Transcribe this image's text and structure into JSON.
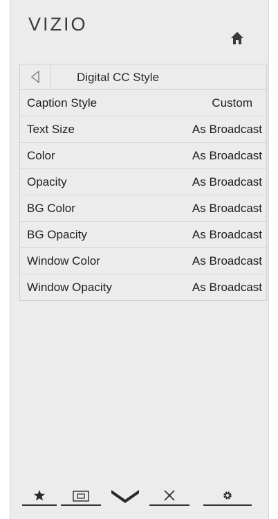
{
  "brand": {
    "logo_text": "VIZIO"
  },
  "header": {
    "home_icon": "home-icon"
  },
  "menu": {
    "title": "Digital CC Style",
    "back_icon": "back-triangle-icon",
    "rows": [
      {
        "label": "Caption Style",
        "value": "Custom"
      },
      {
        "label": "Text Size",
        "value": "As Broadcast"
      },
      {
        "label": "Color",
        "value": "As Broadcast"
      },
      {
        "label": "Opacity",
        "value": "As Broadcast"
      },
      {
        "label": "BG Color",
        "value": "As Broadcast"
      },
      {
        "label": "BG Opacity",
        "value": "As Broadcast"
      },
      {
        "label": "Window Color",
        "value": "As Broadcast"
      },
      {
        "label": "Window Opacity",
        "value": "As Broadcast"
      }
    ]
  },
  "bottom_nav": {
    "buttons": [
      "star-icon",
      "picture-size-icon",
      "chevron-down-icon",
      "close-icon",
      "gear-icon"
    ]
  },
  "colors": {
    "panel_bg": "#ececec",
    "text": "#1e1e1e"
  }
}
